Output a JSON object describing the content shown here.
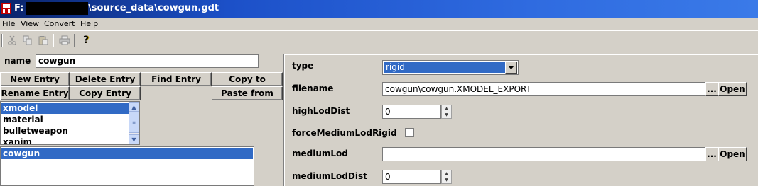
{
  "window": {
    "title_prefix": "F:",
    "title_path": "\\source_data\\cowgun.gdt"
  },
  "menu": [
    "File",
    "View",
    "Convert",
    "Help"
  ],
  "toolbar": {
    "icons": [
      "cut-icon",
      "copy-icon",
      "paste-icon",
      "print-icon",
      "help-icon"
    ],
    "help_glyph": "?"
  },
  "entry_panel": {
    "name_label": "name",
    "name_value": "cowgun",
    "buttons": {
      "new_entry": "New Entry",
      "delete_entry": "Delete Entry",
      "find_entry": "Find Entry",
      "copy_to": "Copy to",
      "rename_entry": "Rename Entry",
      "copy_entry": "Copy Entry",
      "paste_from": "Paste from"
    },
    "types": [
      "xmodel",
      "material",
      "bulletweapon",
      "xanim"
    ],
    "selected_type": "xmodel",
    "entries": [
      "cowgun"
    ],
    "selected_entry": "cowgun"
  },
  "properties": {
    "type": {
      "label": "type",
      "value": "rigid"
    },
    "filename": {
      "label": "filename",
      "value": "cowgun\\cowgun.XMODEL_EXPORT",
      "browse_label": "...",
      "open_label": "Open"
    },
    "highLodDist": {
      "label": "highLodDist",
      "value": "0"
    },
    "forceMediumLodRigid": {
      "label": "forceMediumLodRigid",
      "checked": false
    },
    "mediumLod": {
      "label": "mediumLod",
      "value": "",
      "browse_label": "...",
      "open_label": "Open"
    },
    "mediumLodDist": {
      "label": "mediumLodDist",
      "value": "0"
    }
  },
  "colors": {
    "titlebar": "#0a246a",
    "selection": "#316ac5",
    "face": "#d4d0c8"
  }
}
